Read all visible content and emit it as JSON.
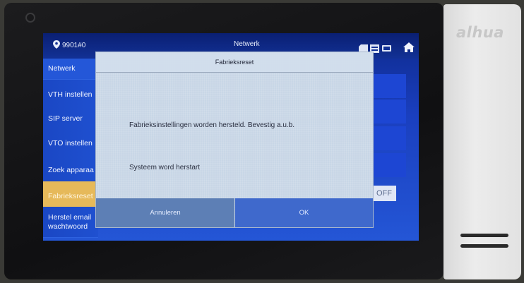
{
  "topbar": {
    "device_id": "9901#0",
    "title": "Netwerk"
  },
  "sidebar": {
    "items": [
      {
        "label": "Netwerk"
      },
      {
        "label": "VTH instellen"
      },
      {
        "label": "SIP server"
      },
      {
        "label": "VTO instellen"
      },
      {
        "label": "Zoek apparaa"
      },
      {
        "label": "Fabrieksreset"
      },
      {
        "label": "Herstel email wachtwoord"
      }
    ]
  },
  "toggle": {
    "label": "OFF"
  },
  "dialog": {
    "title": "Fabrieksreset",
    "message1": "Fabrieksinstellingen worden hersteld. Bevestig a.u.b.",
    "message2": "Systeem word herstart",
    "cancel_label": "Annuleren",
    "ok_label": "OK"
  },
  "device": {
    "brand": "alhua"
  },
  "icons": {
    "location": "location-pin-icon",
    "sd_card": "sd-card-icon",
    "storage": "storage-icon",
    "network": "network-icon",
    "home": "home-icon"
  },
  "colors": {
    "screen_blue": "#1a3fbf",
    "active_item": "#e6b95a",
    "ok_button": "#3f69cc"
  }
}
